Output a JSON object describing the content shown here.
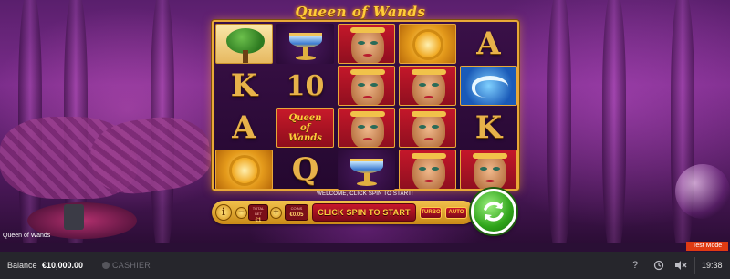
{
  "game": {
    "logo_text": "Queen of Wands",
    "title_bar": "Queen of Wands",
    "message": "WELCOME, CLICK SPIN TO START!",
    "logo_symbol_lines": [
      "Queen",
      "of",
      "Wands"
    ]
  },
  "reels": [
    [
      "tree",
      "K",
      "A",
      "sun"
    ],
    [
      "chalice",
      "10",
      "queen-of-wands-logo",
      "Q"
    ],
    [
      "queen",
      "queen",
      "queen",
      "chalice"
    ],
    [
      "sun",
      "queen",
      "queen",
      "queen"
    ],
    [
      "A",
      "wave",
      "K",
      "queen"
    ]
  ],
  "controls": {
    "info_label": "i",
    "minus_label": "−",
    "plus_label": "+",
    "total_bet_label": "TOTAL BET",
    "total_bet_value": "€1",
    "coins_label": "COINS",
    "coins_value": "€0.05",
    "spin_to_start_label": "CLICK SPIN TO START",
    "turbo_label": "TURBO",
    "auto_label": "AUTO"
  },
  "badge": {
    "test_mode": "Test Mode"
  },
  "bottom_bar": {
    "balance_label": "Balance",
    "balance_value": "€10,000.00",
    "cashier_label": "CASHIER",
    "help_icon": "?",
    "time": "19:38"
  }
}
